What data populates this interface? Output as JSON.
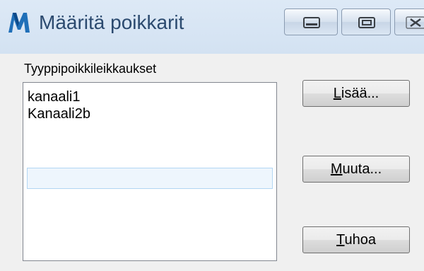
{
  "window": {
    "title": "Määritä poikkarit",
    "icon": "app-logo-icon"
  },
  "caption_buttons": {
    "minimize_icon": "minimize-icon",
    "maximize_icon": "maximize-icon",
    "close_icon": "close-icon"
  },
  "group": {
    "label": "Tyyppipoikkileikkaukset"
  },
  "list": {
    "items": [
      "kanaali1",
      "Kanaali2b"
    ]
  },
  "buttons": {
    "add": {
      "accel": "L",
      "rest": "isää..."
    },
    "edit": {
      "accel": "M",
      "rest": "uuta..."
    },
    "delete": {
      "accel": "T",
      "rest": "uhoa"
    }
  },
  "colors": {
    "title_text": "#2b4a6f",
    "titlebar": "#d9e6f4",
    "dialog_bg": "#f0f0f0",
    "focus_row_border": "#b2d6f3"
  }
}
